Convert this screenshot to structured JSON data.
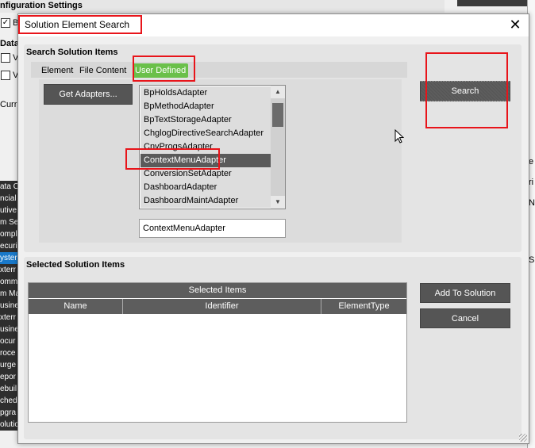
{
  "background": {
    "title": "nfiguration Settings",
    "left_items": [
      "B",
      "Datas",
      "V",
      "V",
      "Curr"
    ],
    "side_items": [
      "ata C",
      "ncial",
      "utive",
      "m Se",
      "ompl",
      "ecuri",
      "yster",
      "xterr",
      "omm",
      "m Ma",
      "usine",
      "xterr",
      "usine",
      "ocur",
      "roce",
      "urge",
      "epor",
      "ebuil",
      "ched",
      "pgra",
      "olution Management"
    ],
    "right_letters": [
      "e",
      "ri",
      "N",
      "S"
    ]
  },
  "dialog": {
    "title": "Solution Element Search",
    "close_glyph": "✕",
    "search_panel": {
      "heading": "Search Solution Items",
      "tabs": [
        "Element",
        "File Content",
        "User Defined"
      ],
      "active_tab": "User Defined",
      "get_adapters_label": "Get Adapters...",
      "adapters": [
        "BpHoldsAdapter",
        "BpMethodAdapter",
        "BpTextStorageAdapter",
        "ChglogDirectiveSearchAdapter",
        "CnvProgsAdapter",
        "ContextMenuAdapter",
        "ConversionSetAdapter",
        "DashboardAdapter",
        "DashboardMaintAdapter"
      ],
      "selected_adapter": "ContextMenuAdapter",
      "adapter_value": "ContextMenuAdapter",
      "search_label": "Search"
    },
    "selected_panel": {
      "heading": "Selected Solution Items",
      "grid_caption": "Selected Items",
      "columns": [
        "Name",
        "Identifier",
        "ElementType"
      ],
      "add_label": "Add To Solution",
      "cancel_label": "Cancel"
    }
  },
  "colors": {
    "active_tab": "#6ac04a",
    "dark_button": "#555555",
    "selection": "#5a5a5a",
    "annotation": "#e8141a",
    "side_selected": "#1979ca"
  }
}
